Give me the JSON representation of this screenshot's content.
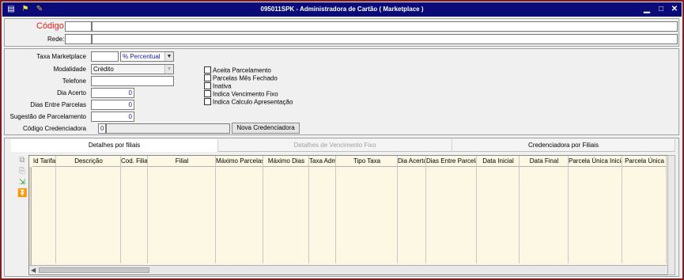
{
  "window": {
    "title": "095011SPK - Administradora de Cartão ( Marketplace )",
    "minimize": "▁",
    "maximize": "□",
    "close": "✕"
  },
  "header": {
    "codigo_label": "Código",
    "codigo_value": "",
    "rede_label": "Rede:",
    "rede_value": ""
  },
  "form": {
    "taxa_label": "Taxa Marketplace",
    "taxa_value": "",
    "taxa_tipo": "% Percentual",
    "modalidade_label": "Modalidade",
    "modalidade_value": "Crédito",
    "telefone_label": "Telefone",
    "telefone_value": "",
    "dia_acerto_label": "Dia Acerto",
    "dia_acerto_value": "0",
    "dias_parcelas_label": "Dias Entre Parcelas",
    "dias_parcelas_value": "0",
    "sugestao_label": "Sugestão de Parcelamento",
    "sugestao_value": "0",
    "cod_cred_label": "Código Credenciadora",
    "cod_cred_value": "0",
    "cod_cred_desc": "",
    "nova_cred_button": "Nova Credenciadora"
  },
  "checkboxes": [
    {
      "label": "Aceita Parcelamento",
      "checked": false
    },
    {
      "label": "Parcelas Mês Fechado",
      "checked": false
    },
    {
      "label": "Inativa",
      "checked": false
    },
    {
      "label": "Indica Vencimento Fixo",
      "checked": false
    },
    {
      "label": "Indica Calculo Apresentação",
      "checked": false
    }
  ],
  "tabs": [
    {
      "label": "Detalhes por filiais",
      "active": true
    },
    {
      "label": "Detalhes de Vencimento Fixo",
      "active": false
    },
    {
      "label": "Credenciadora por Filiais",
      "active": false
    }
  ],
  "grid": {
    "columns": [
      "Id Tarifa",
      "Descrição",
      "Cod. Filial",
      "Filial",
      "Máximo Parcelas",
      "Máximo Dias",
      "Taxa Adm",
      "Tipo Taxa",
      "Dia Acerto",
      "Dias Entre Parcelas",
      "Data Inicial",
      "Data Final",
      "Parcela Única Inicial",
      "Parcela Única"
    ]
  },
  "icons": {
    "app": "app-menu-icon",
    "traffic": "traffic-light-icon",
    "tools": "wrench-icon"
  }
}
